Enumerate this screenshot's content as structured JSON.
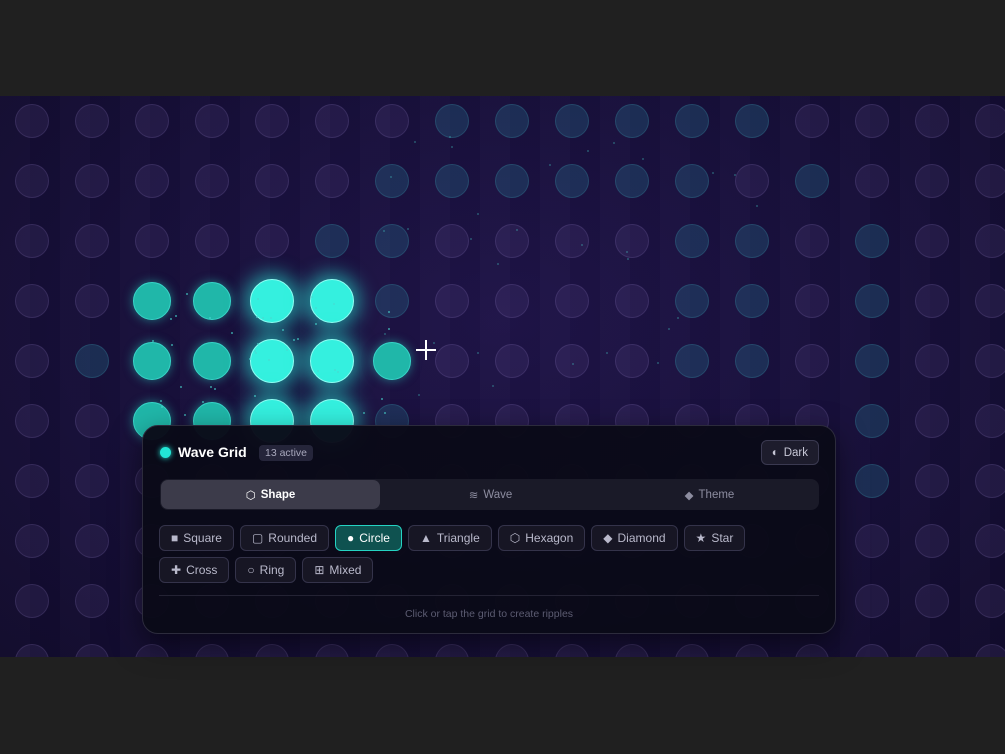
{
  "panel": {
    "title": "Wave Grid",
    "active_badge": "13 active",
    "theme_button": "Dark",
    "tabs": [
      {
        "label": "Shape",
        "icon": "hexagon-icon",
        "active": true
      },
      {
        "label": "Wave",
        "icon": "wave-icon",
        "active": false
      },
      {
        "label": "Theme",
        "icon": "diamond-icon",
        "active": false
      }
    ],
    "shapes": [
      {
        "label": "Square",
        "icon": "square-icon",
        "glyph": "■",
        "active": false
      },
      {
        "label": "Rounded",
        "icon": "rounded-square-icon",
        "glyph": "▢",
        "active": false
      },
      {
        "label": "Circle",
        "icon": "circle-icon",
        "glyph": "●",
        "active": true
      },
      {
        "label": "Triangle",
        "icon": "triangle-icon",
        "glyph": "▲",
        "active": false
      },
      {
        "label": "Hexagon",
        "icon": "hexagon-icon",
        "glyph": "⬡",
        "active": false
      },
      {
        "label": "Diamond",
        "icon": "diamond-icon",
        "glyph": "◆",
        "active": false
      },
      {
        "label": "Star",
        "icon": "star-icon",
        "glyph": "★",
        "active": false
      },
      {
        "label": "Cross",
        "icon": "cross-icon",
        "glyph": "✚",
        "active": false
      },
      {
        "label": "Ring",
        "icon": "ring-icon",
        "glyph": "○",
        "active": false
      },
      {
        "label": "Mixed",
        "icon": "grid-icon",
        "glyph": "⊞",
        "active": false
      }
    ],
    "hint": "Click or tap the grid to create ripples"
  },
  "colors": {
    "accent": "#22e6d6",
    "background": "#170f3a",
    "panel": "#0a0a18"
  }
}
